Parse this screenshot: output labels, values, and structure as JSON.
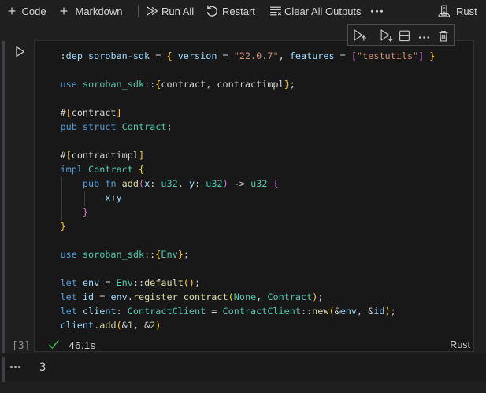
{
  "toolbar": {
    "code_label": "Code",
    "markdown_label": "Markdown",
    "run_all_label": "Run All",
    "restart_label": "Restart",
    "clear_all_outputs_label": "Clear All Outputs",
    "more_actions_icon": "ellipsis-icon",
    "kernel_label": "Rust",
    "kernel_icon": "server-environment-icon"
  },
  "cell_toolbar": {
    "icons": [
      "execute-above-icon",
      "execute-below-icon",
      "split-cell-icon",
      "more-actions-icon",
      "delete-cell-icon"
    ]
  },
  "cell": {
    "run_icon": "run-cell-play-icon",
    "execution_count": "[3]",
    "status_check_icon": "success-check-icon",
    "execution_time": "46.1s",
    "language": "Rust"
  },
  "output": {
    "options_icon": "output-options-ellipsis-icon",
    "value": "3"
  },
  "colors": {
    "page_bg": "#1f1f1f",
    "editor_bg": "#181818",
    "keyword": "#569cd6",
    "variable": "#9cdcfe",
    "type": "#4ec9b0",
    "function": "#dcdcaa",
    "string": "#ce9178",
    "punctuation": "#d4d4d4",
    "bracket_level1": "#ffd700",
    "bracket_level2": "#da70d6",
    "number": "#b5cea8",
    "success_green": "#3fba50"
  },
  "code": {
    "language": "rust",
    "lines": [
      [
        [
          ":",
          "pun"
        ],
        [
          "dep",
          "var"
        ],
        [
          " ",
          "pun"
        ],
        [
          "soroban-sdk",
          "var"
        ],
        [
          " = ",
          "pun"
        ],
        [
          "{",
          "b1"
        ],
        [
          " ",
          "pun"
        ],
        [
          "version",
          "var"
        ],
        [
          " = ",
          "pun"
        ],
        [
          "\"22.0.7\"",
          "str"
        ],
        [
          ", ",
          "pun"
        ],
        [
          "features",
          "var"
        ],
        [
          " = ",
          "pun"
        ],
        [
          "[",
          "b2"
        ],
        [
          "\"testutils\"",
          "str"
        ],
        [
          "]",
          "b2"
        ],
        [
          " ",
          "pun"
        ],
        [
          "}",
          "b1"
        ]
      ],
      [],
      [
        [
          "use",
          "kw"
        ],
        [
          " ",
          "pun"
        ],
        [
          "soroban_sdk",
          "type"
        ],
        [
          "::",
          "pun"
        ],
        [
          "{",
          "b1"
        ],
        [
          "contract, contractimpl",
          "pun"
        ],
        [
          "}",
          "b1"
        ],
        [
          ";",
          "pun"
        ]
      ],
      [],
      [
        [
          "#",
          "pun"
        ],
        [
          "[",
          "b1"
        ],
        [
          "contract",
          "pun"
        ],
        [
          "]",
          "b1"
        ]
      ],
      [
        [
          "pub",
          "kw"
        ],
        [
          " ",
          "pun"
        ],
        [
          "struct",
          "kw"
        ],
        [
          " ",
          "pun"
        ],
        [
          "Contract",
          "type"
        ],
        [
          ";",
          "pun"
        ]
      ],
      [],
      [
        [
          "#",
          "pun"
        ],
        [
          "[",
          "b1"
        ],
        [
          "contractimpl",
          "pun"
        ],
        [
          "]",
          "b1"
        ]
      ],
      [
        [
          "impl",
          "kw"
        ],
        [
          " ",
          "pun"
        ],
        [
          "Contract",
          "type"
        ],
        [
          " ",
          "pun"
        ],
        [
          "{",
          "b1"
        ]
      ],
      [
        [
          "    ",
          "pun"
        ],
        [
          "pub",
          "kw"
        ],
        [
          " ",
          "pun"
        ],
        [
          "fn",
          "kw"
        ],
        [
          " ",
          "pun"
        ],
        [
          "add",
          "fn"
        ],
        [
          "(",
          "b2"
        ],
        [
          "x",
          "var"
        ],
        [
          ": ",
          "pun"
        ],
        [
          "u32",
          "type"
        ],
        [
          ", ",
          "pun"
        ],
        [
          "y",
          "var"
        ],
        [
          ": ",
          "pun"
        ],
        [
          "u32",
          "type"
        ],
        [
          ")",
          "b2"
        ],
        [
          " -> ",
          "pun"
        ],
        [
          "u32",
          "type"
        ],
        [
          " ",
          "pun"
        ],
        [
          "{",
          "b2"
        ]
      ],
      [
        [
          "        ",
          "pun"
        ],
        [
          "x",
          "var"
        ],
        [
          "+",
          "pun"
        ],
        [
          "y",
          "var"
        ]
      ],
      [
        [
          "    ",
          "pun"
        ],
        [
          "}",
          "b2"
        ]
      ],
      [
        [
          "}",
          "b1"
        ]
      ],
      [],
      [
        [
          "use",
          "kw"
        ],
        [
          " ",
          "pun"
        ],
        [
          "soroban_sdk",
          "type"
        ],
        [
          "::",
          "pun"
        ],
        [
          "{",
          "b1"
        ],
        [
          "Env",
          "type"
        ],
        [
          "}",
          "b1"
        ],
        [
          ";",
          "pun"
        ]
      ],
      [],
      [
        [
          "let",
          "kw"
        ],
        [
          " ",
          "pun"
        ],
        [
          "env",
          "var"
        ],
        [
          " = ",
          "pun"
        ],
        [
          "Env",
          "type"
        ],
        [
          "::",
          "pun"
        ],
        [
          "default",
          "fn"
        ],
        [
          "()",
          "b1"
        ],
        [
          ";",
          "pun"
        ]
      ],
      [
        [
          "let",
          "kw"
        ],
        [
          " ",
          "pun"
        ],
        [
          "id",
          "var"
        ],
        [
          " = ",
          "pun"
        ],
        [
          "env",
          "var"
        ],
        [
          ".",
          "pun"
        ],
        [
          "register_contract",
          "fn"
        ],
        [
          "(",
          "b1"
        ],
        [
          "None",
          "type"
        ],
        [
          ", ",
          "pun"
        ],
        [
          "Contract",
          "type"
        ],
        [
          ")",
          "b1"
        ],
        [
          ";",
          "pun"
        ]
      ],
      [
        [
          "let",
          "kw"
        ],
        [
          " ",
          "pun"
        ],
        [
          "client",
          "var"
        ],
        [
          ": ",
          "pun"
        ],
        [
          "ContractClient",
          "type"
        ],
        [
          " = ",
          "pun"
        ],
        [
          "ContractClient",
          "type"
        ],
        [
          "::",
          "pun"
        ],
        [
          "new",
          "fn"
        ],
        [
          "(",
          "b1"
        ],
        [
          "&",
          "pun"
        ],
        [
          "env",
          "var"
        ],
        [
          ", &",
          "pun"
        ],
        [
          "id",
          "var"
        ],
        [
          ")",
          "b1"
        ],
        [
          ";",
          "pun"
        ]
      ],
      [
        [
          "client",
          "var"
        ],
        [
          ".",
          "pun"
        ],
        [
          "add",
          "fn"
        ],
        [
          "(",
          "b1"
        ],
        [
          "&",
          "pun"
        ],
        [
          "1",
          "num"
        ],
        [
          ", &",
          "pun"
        ],
        [
          "2",
          "num"
        ],
        [
          ")",
          "b1"
        ]
      ]
    ]
  }
}
